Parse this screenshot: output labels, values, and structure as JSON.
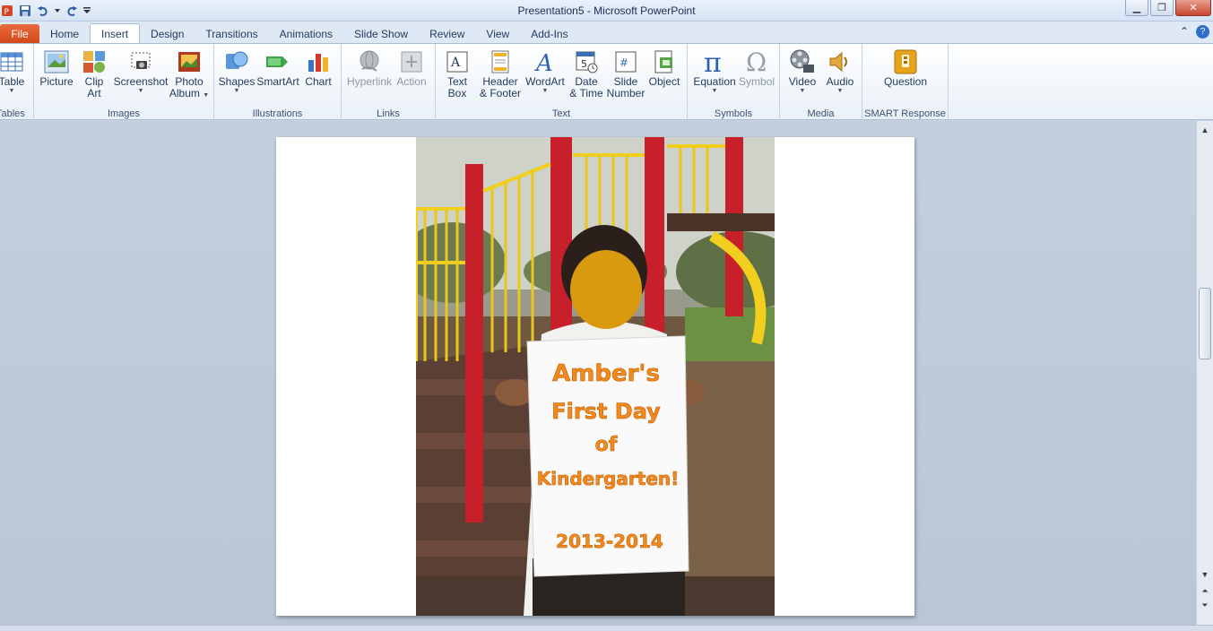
{
  "window": {
    "title": "Presentation5  -  Microsoft PowerPoint",
    "controls": [
      "minimize",
      "restore",
      "close"
    ]
  },
  "tabs": [
    {
      "label": "File"
    },
    {
      "label": "Home"
    },
    {
      "label": "Insert"
    },
    {
      "label": "Design"
    },
    {
      "label": "Transitions"
    },
    {
      "label": "Animations"
    },
    {
      "label": "Slide Show"
    },
    {
      "label": "Review"
    },
    {
      "label": "View"
    },
    {
      "label": "Add-Ins"
    }
  ],
  "ribbon": {
    "groups": {
      "tables": "Tables",
      "images": "Images",
      "illustrations": "Illustrations",
      "links": "Links",
      "text": "Text",
      "symbols": "Symbols",
      "media": "Media",
      "smart": "SMART Response"
    },
    "buttons": {
      "table": "Table",
      "picture": "Picture",
      "clipart_1": "Clip",
      "clipart_2": "Art",
      "screenshot": "Screenshot",
      "photoalbum_1": "Photo",
      "photoalbum_2": "Album",
      "shapes": "Shapes",
      "smartart": "SmartArt",
      "chart": "Chart",
      "hyperlink": "Hyperlink",
      "action": "Action",
      "textbox_1": "Text",
      "textbox_2": "Box",
      "header_1": "Header",
      "header_2": "& Footer",
      "wordart": "WordArt",
      "date_1": "Date",
      "date_2": "& Time",
      "slidenum_1": "Slide",
      "slidenum_2": "Number",
      "object": "Object",
      "equation": "Equation",
      "symbol": "Symbol",
      "video": "Video",
      "audio": "Audio",
      "question": "Question"
    }
  },
  "slide": {
    "sign": {
      "line1": "Amber's",
      "line2": "First Day",
      "line3": "of",
      "line4": "Kindergarten!",
      "line5": "2013-2014"
    }
  },
  "colors": {
    "file_tab": "#d24719",
    "sign_text": "#f08a1c",
    "face_cover": "#d99a10"
  }
}
